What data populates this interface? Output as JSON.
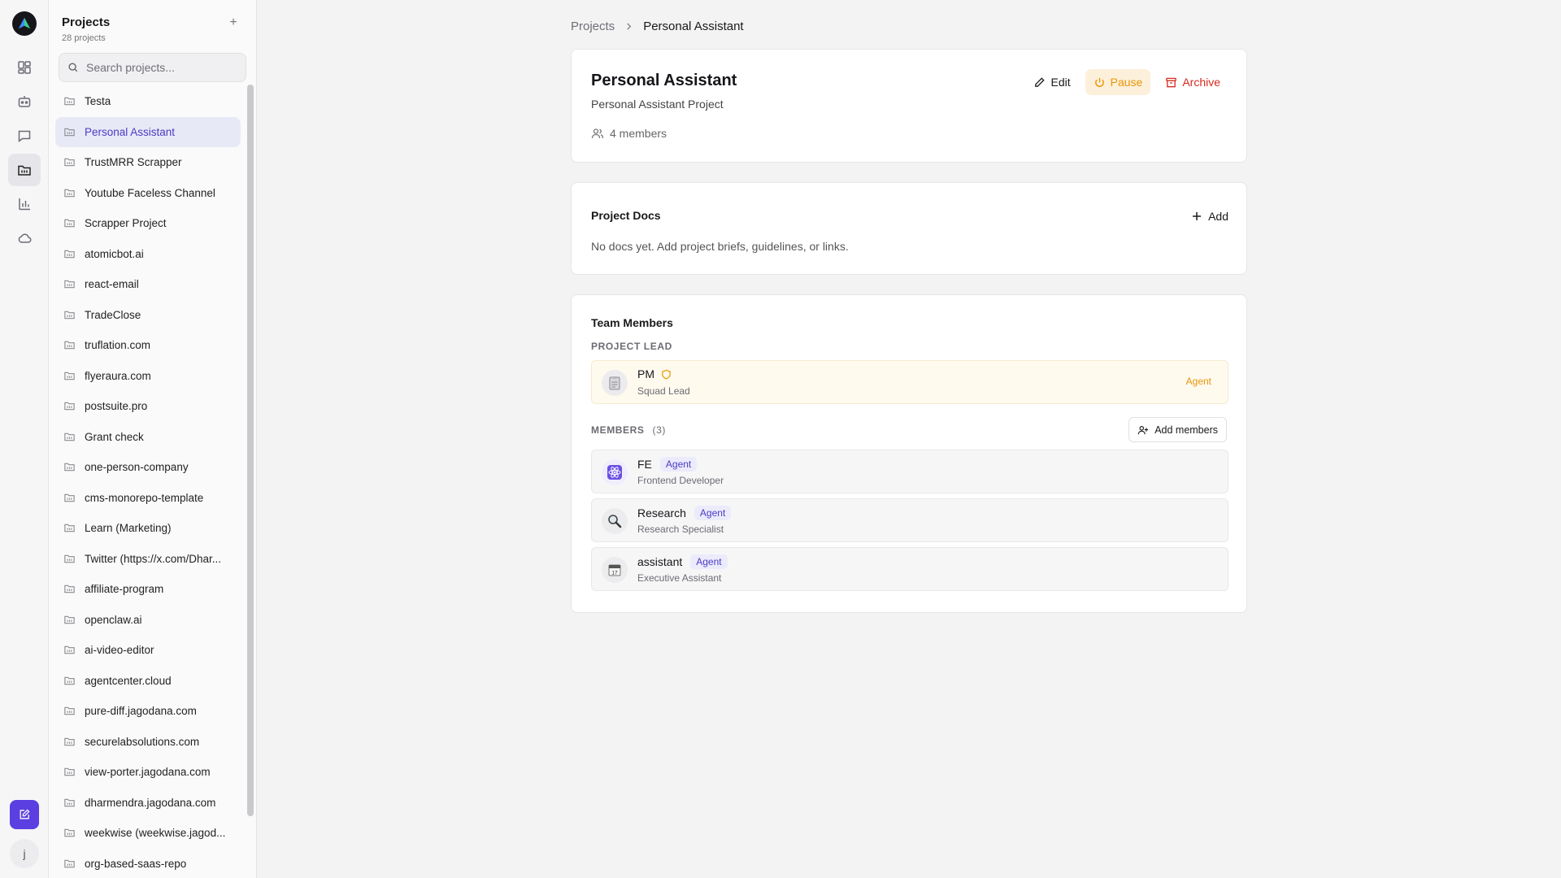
{
  "sidebar": {
    "title": "Projects",
    "count": "28 projects",
    "add": "+",
    "search_placeholder": "Search projects...",
    "items": [
      {
        "label": "Testa"
      },
      {
        "label": "Personal Assistant"
      },
      {
        "label": "TrustMRR Scrapper"
      },
      {
        "label": "Youtube Faceless Channel"
      },
      {
        "label": "Scrapper Project"
      },
      {
        "label": "atomicbot.ai"
      },
      {
        "label": "react-email"
      },
      {
        "label": "TradeClose"
      },
      {
        "label": "truflation.com"
      },
      {
        "label": "flyeraura.com"
      },
      {
        "label": "postsuite.pro"
      },
      {
        "label": "Grant check"
      },
      {
        "label": "one-person-company"
      },
      {
        "label": "cms-monorepo-template"
      },
      {
        "label": "Learn (Marketing)"
      },
      {
        "label": "Twitter (https://x.com/Dhar..."
      },
      {
        "label": "affiliate-program"
      },
      {
        "label": "openclaw.ai"
      },
      {
        "label": "ai-video-editor"
      },
      {
        "label": "agentcenter.cloud"
      },
      {
        "label": "pure-diff.jagodana.com"
      },
      {
        "label": "securelabsolutions.com"
      },
      {
        "label": "view-porter.jagodana.com"
      },
      {
        "label": "dharmendra.jagodana.com"
      },
      {
        "label": "weekwise (weekwise.jagod..."
      },
      {
        "label": "org-based-saas-repo"
      }
    ]
  },
  "user": {
    "initial": "j"
  },
  "breadcrumb": {
    "root": "Projects",
    "current": "Personal Assistant"
  },
  "project": {
    "title": "Personal Assistant",
    "description": "Personal Assistant Project",
    "members": "4 members",
    "edit": "Edit",
    "pause": "Pause",
    "archive": "Archive"
  },
  "docs": {
    "title": "Project Docs",
    "add": "Add",
    "empty": "No docs yet. Add project briefs, guidelines, or links."
  },
  "team": {
    "title": "Team Members",
    "lead_label": "PROJECT LEAD",
    "lead": {
      "name": "PM",
      "role": "Squad Lead",
      "badge": "Agent"
    },
    "members_label": "MEMBERS",
    "members_count": "(3)",
    "add_members": "Add members",
    "members": [
      {
        "name": "FE",
        "role": "Frontend Developer",
        "badge": "Agent"
      },
      {
        "name": "Research",
        "role": "Research Specialist",
        "badge": "Agent"
      },
      {
        "name": "assistant",
        "role": "Executive Assistant",
        "badge": "Agent"
      }
    ]
  },
  "colors": {
    "accent": "#5b3fe0",
    "pause": "#e8950a",
    "archive": "#d72b1f",
    "agent_badge": "#4b3bc4"
  }
}
